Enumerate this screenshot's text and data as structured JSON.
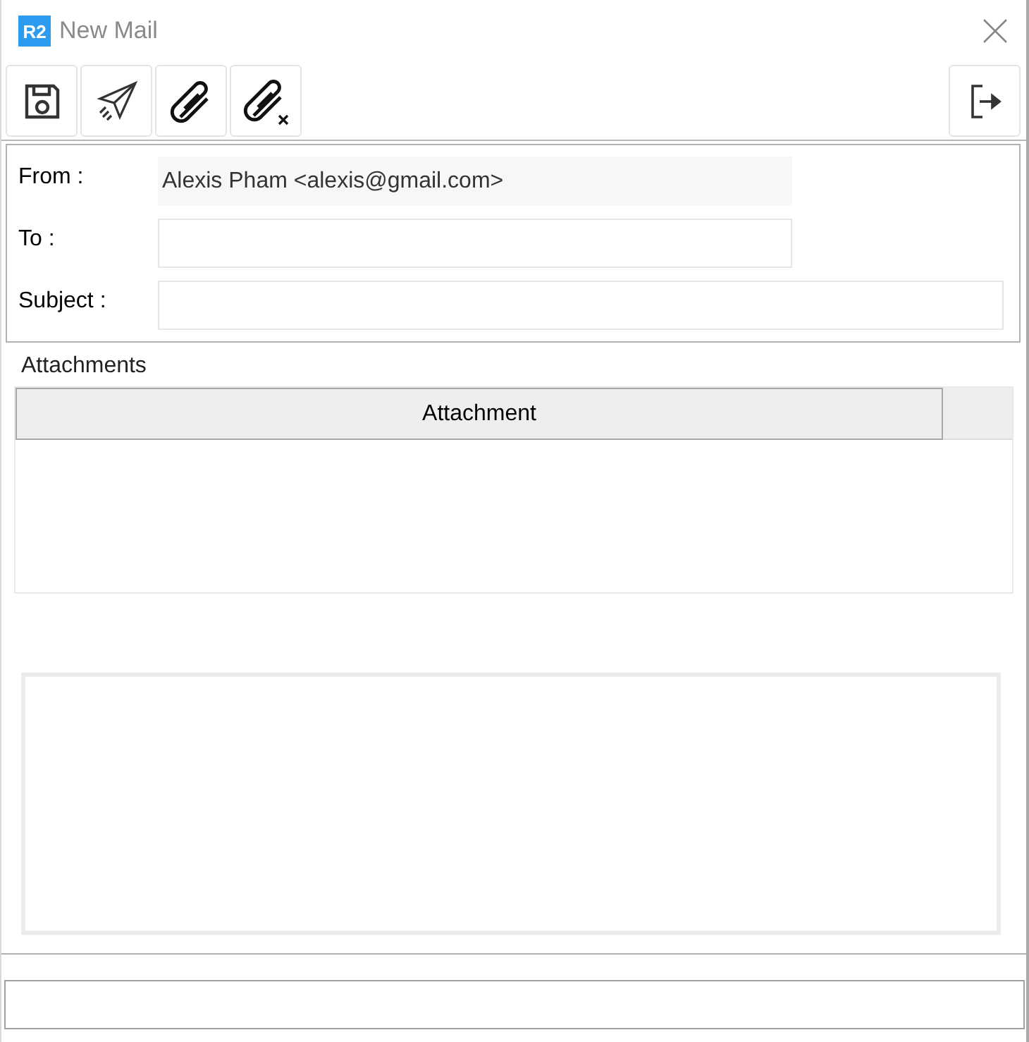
{
  "window": {
    "app_badge": "R2",
    "title": "New Mail"
  },
  "toolbar": [
    {
      "kind": "save"
    },
    {
      "kind": "send"
    },
    {
      "kind": "attach"
    },
    {
      "kind": "detach"
    }
  ],
  "toolbar_right": [
    {
      "kind": "exit"
    }
  ],
  "form": {
    "fields": [
      {
        "label": "From :",
        "value": "Alexis Pham <alexis@gmail.com>",
        "kind": "readonly"
      },
      {
        "label": "To :",
        "kind": "short"
      },
      {
        "label": "Subject :",
        "kind": "wide"
      }
    ]
  },
  "attachments": {
    "title": "Attachments",
    "columns": [
      "Attachment"
    ]
  }
}
